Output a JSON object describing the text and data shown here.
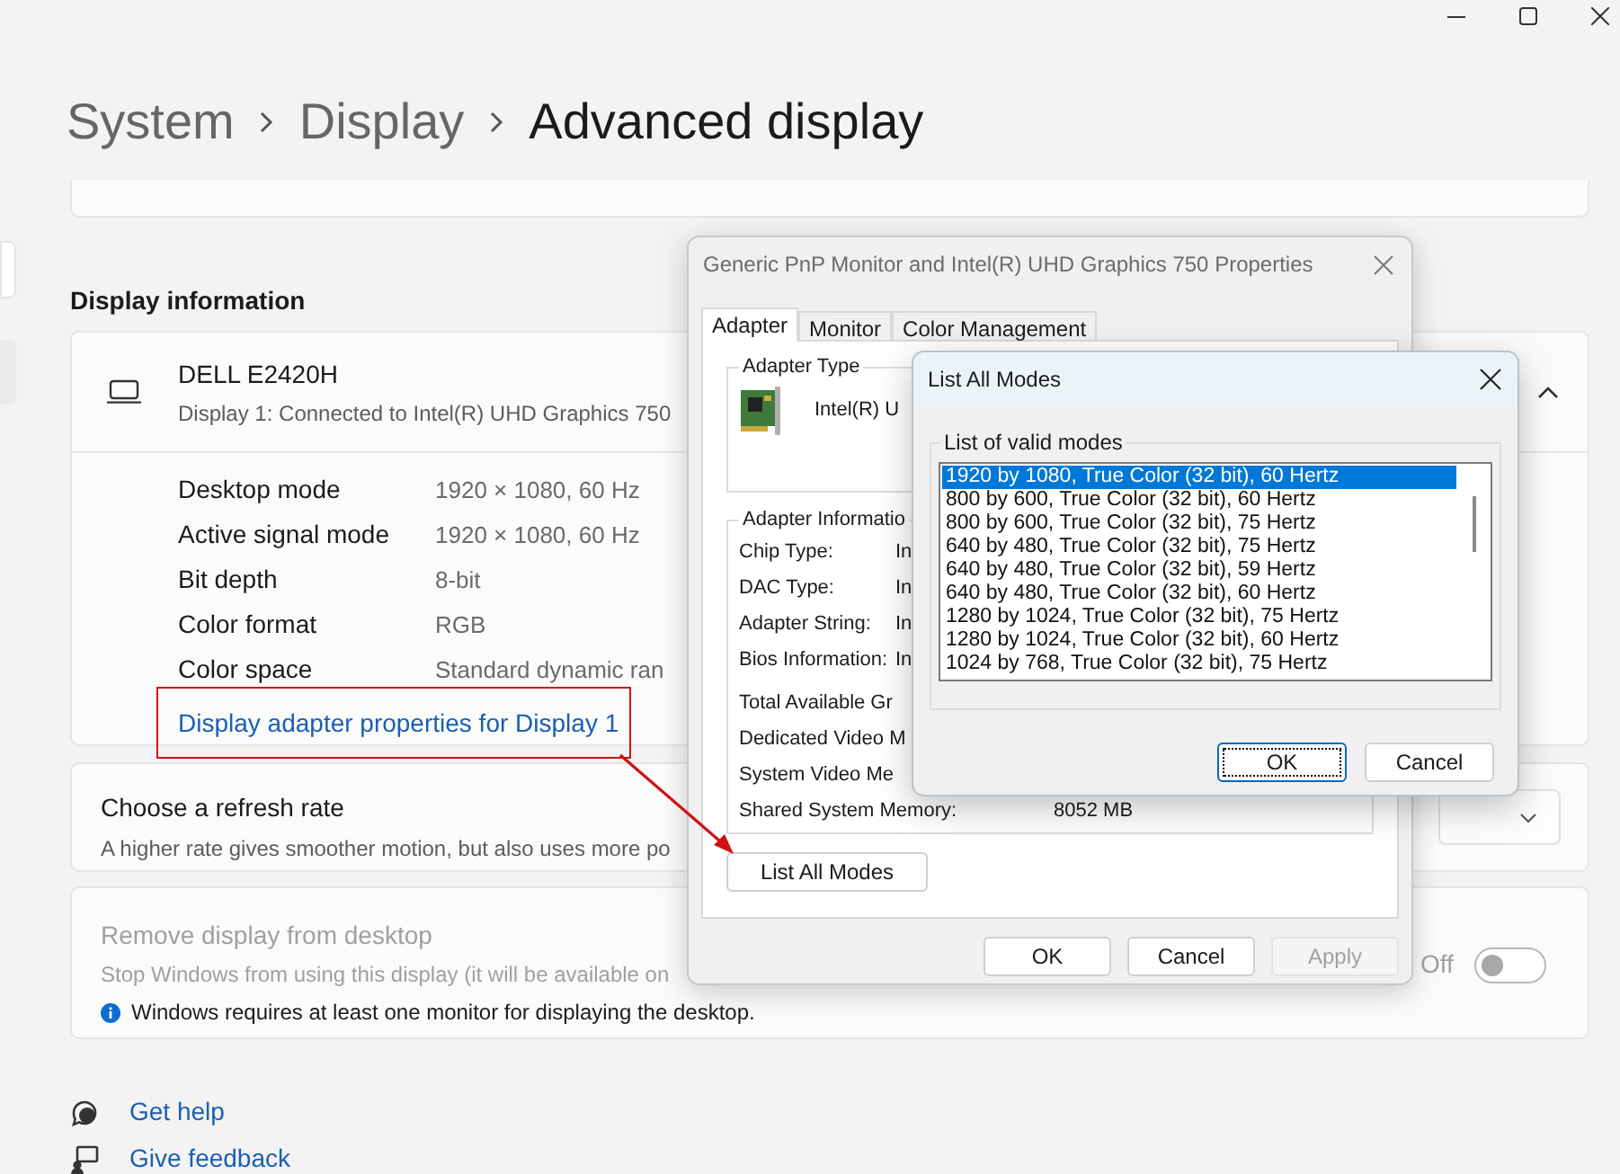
{
  "breadcrumb": [
    {
      "label": "System",
      "current": false
    },
    {
      "label": "Display",
      "current": false
    },
    {
      "label": "Advanced display",
      "current": true
    }
  ],
  "section_title": "Display information",
  "display_card": {
    "name": "DELL E2420H",
    "subtitle": "Display 1: Connected to Intel(R) UHD Graphics 750",
    "expanded": true,
    "details": [
      {
        "label": "Desktop mode",
        "value": "1920 × 1080, 60 Hz"
      },
      {
        "label": "Active signal mode",
        "value": "1920 × 1080, 60 Hz"
      },
      {
        "label": "Bit depth",
        "value": "8-bit"
      },
      {
        "label": "Color format",
        "value": "RGB"
      },
      {
        "label": "Color space",
        "value": "Standard dynamic ran"
      }
    ],
    "link": "Display adapter properties for Display 1"
  },
  "refresh_card": {
    "title": "Choose a refresh rate",
    "description": "A higher rate gives smoother motion, but also uses more po"
  },
  "remove_card": {
    "title": "Remove display from desktop",
    "description": "Stop Windows from using this display (it will be available on",
    "note": "Windows requires at least one monitor for displaying the desktop.",
    "disabled": true,
    "toggle_label": "Off",
    "toggle_on": false
  },
  "footer_links": [
    "Get help",
    "Give feedback"
  ],
  "properties_dialog": {
    "title": "Generic PnP Monitor and Intel(R) UHD Graphics 750 Properties",
    "tabs": [
      {
        "label": "Adapter",
        "selected": true
      },
      {
        "label": "Monitor",
        "selected": false
      },
      {
        "label": "Color Management",
        "selected": false
      }
    ],
    "adapter_type": {
      "legend": "Adapter Type",
      "name": "Intel(R) U"
    },
    "adapter_info": {
      "legend": "Adapter Informatio",
      "rows": [
        {
          "label": "Chip Type:",
          "value": "In"
        },
        {
          "label": "DAC Type:",
          "value": "In"
        },
        {
          "label": "Adapter String:",
          "value": "In"
        },
        {
          "label": "Bios Information:",
          "value": "In"
        }
      ]
    },
    "memory_rows": [
      {
        "label": "Total Available Gr"
      },
      {
        "label": "Dedicated Video M"
      },
      {
        "label": "System Video Me"
      },
      {
        "label": "Shared System Memory:",
        "value": "8052 MB"
      }
    ],
    "list_modes_button": "List All Modes",
    "buttons": [
      {
        "label": "OK",
        "disabled": false
      },
      {
        "label": "Cancel",
        "disabled": false
      },
      {
        "label": "Apply",
        "disabled": true
      }
    ]
  },
  "modes_dialog": {
    "title": "List All Modes",
    "legend": "List of valid modes",
    "modes": [
      {
        "label": "1920 by 1080, True Color (32 bit), 60 Hertz",
        "selected": true
      },
      {
        "label": "800 by 600, True Color (32 bit), 60 Hertz",
        "selected": false
      },
      {
        "label": "800 by 600, True Color (32 bit), 75 Hertz",
        "selected": false
      },
      {
        "label": "640 by 480, True Color (32 bit), 75 Hertz",
        "selected": false
      },
      {
        "label": "640 by 480, True Color (32 bit), 59 Hertz",
        "selected": false
      },
      {
        "label": "640 by 480, True Color (32 bit), 60 Hertz",
        "selected": false
      },
      {
        "label": "1280 by 1024, True Color (32 bit), 75 Hertz",
        "selected": false
      },
      {
        "label": "1280 by 1024, True Color (32 bit), 60 Hertz",
        "selected": false
      },
      {
        "label": "1024 by 768, True Color (32 bit), 75 Hertz",
        "selected": false
      }
    ],
    "buttons": [
      {
        "label": "OK",
        "focused": true
      },
      {
        "label": "Cancel",
        "focused": false
      }
    ]
  }
}
